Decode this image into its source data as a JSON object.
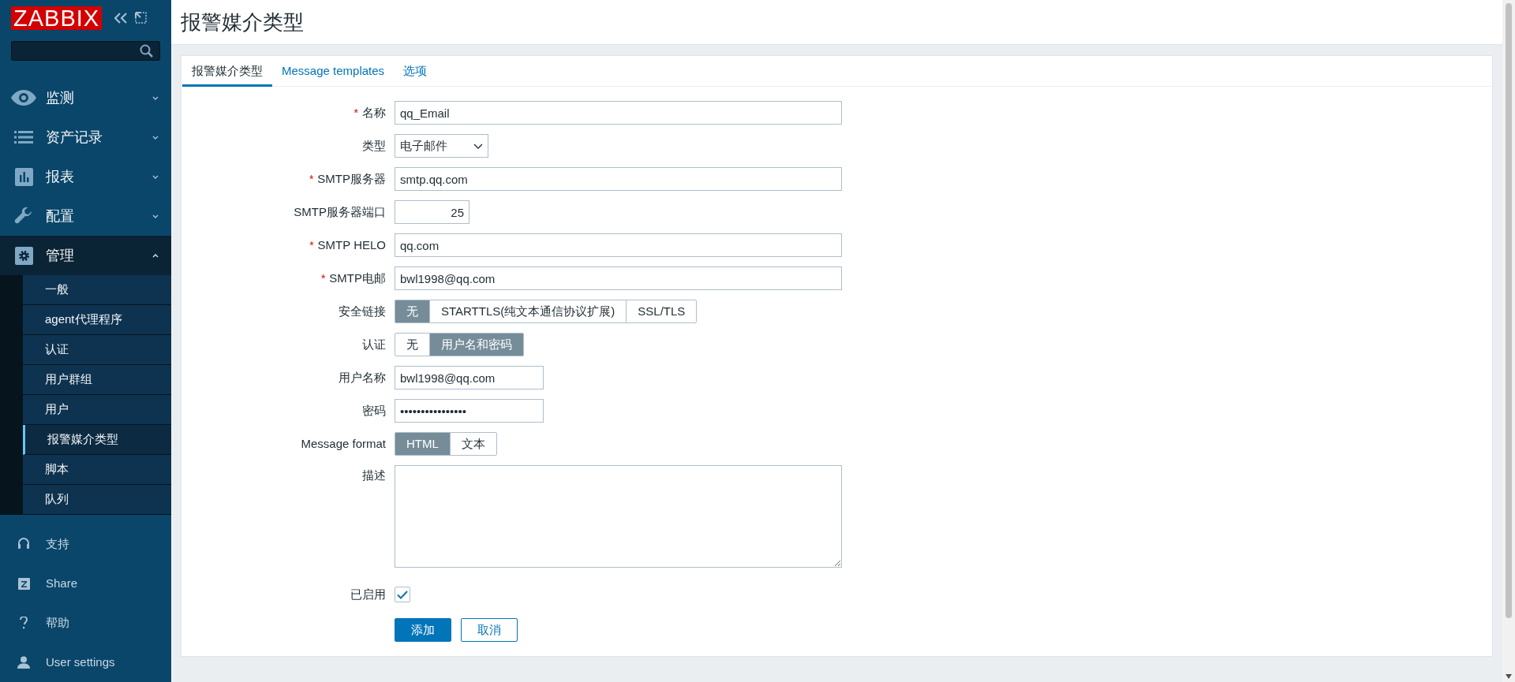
{
  "sidebar": {
    "logo": "ZABBIX",
    "menu": [
      {
        "label": "监测",
        "expanded": false
      },
      {
        "label": "资产记录",
        "expanded": false
      },
      {
        "label": "报表",
        "expanded": false
      },
      {
        "label": "配置",
        "expanded": false
      },
      {
        "label": "管理",
        "expanded": true,
        "children": [
          {
            "label": "一般",
            "selected": false
          },
          {
            "label": "agent代理程序",
            "selected": false
          },
          {
            "label": "认证",
            "selected": false
          },
          {
            "label": "用户群组",
            "selected": false
          },
          {
            "label": "用户",
            "selected": false
          },
          {
            "label": "报警媒介类型",
            "selected": true
          },
          {
            "label": "脚本",
            "selected": false
          },
          {
            "label": "队列",
            "selected": false
          }
        ]
      }
    ],
    "bottom": [
      {
        "label": "支持"
      },
      {
        "label": "Share"
      },
      {
        "label": "帮助"
      },
      {
        "label": "User settings"
      }
    ]
  },
  "page_title": "报警媒介类型",
  "tabs": [
    {
      "label": "报警媒介类型",
      "selected": true
    },
    {
      "label": "Message templates",
      "selected": false
    },
    {
      "label": "选项",
      "selected": false
    }
  ],
  "form": [
    {
      "kind": "text",
      "asterisk": "*",
      "label": "名称",
      "value": "qq_Email"
    },
    {
      "kind": "select",
      "label": "类型",
      "value": "电子邮件"
    },
    {
      "kind": "text",
      "asterisk": "*",
      "label": "SMTP服务器",
      "value": "smtp.qq.com"
    },
    {
      "kind": "number",
      "label": "SMTP服务器端口",
      "value": "25"
    },
    {
      "kind": "text",
      "asterisk": "*",
      "label": "SMTP HELO",
      "value": "qq.com"
    },
    {
      "kind": "text",
      "asterisk": "*",
      "label": "SMTP电邮",
      "value": "bwl1998@qq.com"
    },
    {
      "kind": "segmented",
      "label": "安全链接",
      "options": [
        {
          "label": "无",
          "selected": true
        },
        {
          "label": "STARTTLS(纯文本通信协议扩展)",
          "selected": false
        },
        {
          "label": "SSL/TLS",
          "selected": false
        }
      ]
    },
    {
      "kind": "segmented",
      "label": "认证",
      "options": [
        {
          "label": "无",
          "selected": false
        },
        {
          "label": "用户名和密码",
          "selected": true
        }
      ]
    },
    {
      "kind": "short",
      "label": "用户名称",
      "value": "bwl1998@qq.com"
    },
    {
      "kind": "short",
      "label": "密码",
      "value": "••••••••••••••••"
    },
    {
      "kind": "segmented",
      "label": "Message format",
      "options": [
        {
          "label": "HTML",
          "selected": true
        },
        {
          "label": "文本",
          "selected": false
        }
      ]
    },
    {
      "kind": "textarea",
      "label": "描述"
    },
    {
      "kind": "checkbox",
      "label": "已启用",
      "checked": true
    }
  ],
  "buttons": [
    {
      "label": "添加",
      "kind": "primary"
    },
    {
      "label": "取消",
      "kind": "secondary"
    }
  ]
}
